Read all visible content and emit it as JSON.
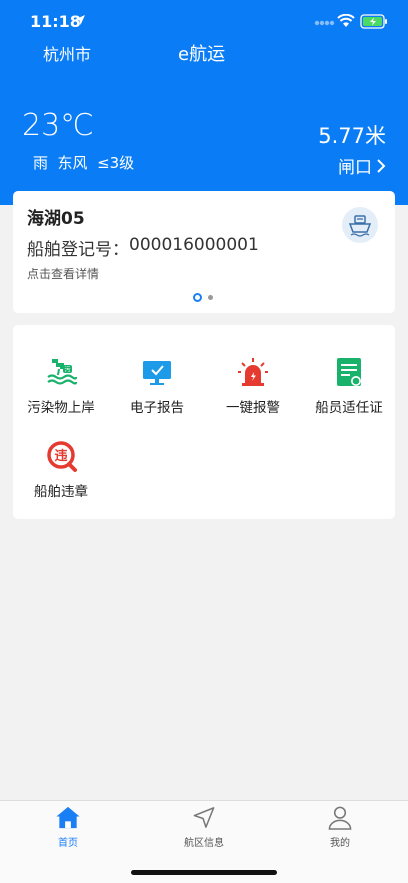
{
  "status_bar": {
    "time": "11:18"
  },
  "header": {
    "city": "杭州市",
    "app_title": "e航运",
    "temperature": "23℃",
    "weather": "雨  东风  ≤3级",
    "water_level": "5.77米",
    "station": "闸口"
  },
  "vessel": {
    "name": "海湖05",
    "registration_label": "船舶登记号：",
    "registration_number": "000016000001",
    "detail_link": "点击查看详情",
    "pager_count": 2,
    "pager_active": 1
  },
  "functions": [
    {
      "label": "污染物上岸",
      "icon": "pollutant-discharge-icon"
    },
    {
      "label": "电子报告",
      "icon": "electronic-report-icon"
    },
    {
      "label": "一键报警",
      "icon": "alarm-siren-icon"
    },
    {
      "label": "船员适任证",
      "icon": "crew-certificate-icon"
    },
    {
      "label": "船舶违章",
      "icon": "ship-violation-icon"
    }
  ],
  "tabbar": {
    "tabs": [
      {
        "label": "首页",
        "icon": "home-icon",
        "active": true
      },
      {
        "label": "航区信息",
        "icon": "navigation-arrow-icon",
        "active": false
      },
      {
        "label": "我的",
        "icon": "user-icon",
        "active": false
      }
    ]
  },
  "colors": {
    "primary": "#0a7cf6",
    "green": "#19b26b",
    "red": "#e53a2f",
    "tab_active": "#1a7ff5"
  }
}
